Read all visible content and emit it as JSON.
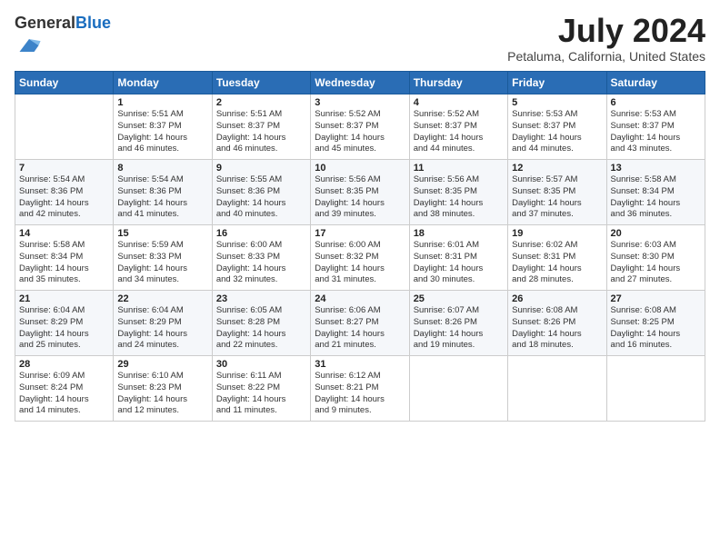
{
  "logo": {
    "general": "General",
    "blue": "Blue"
  },
  "title": {
    "month_year": "July 2024",
    "location": "Petaluma, California, United States"
  },
  "header_days": [
    "Sunday",
    "Monday",
    "Tuesday",
    "Wednesday",
    "Thursday",
    "Friday",
    "Saturday"
  ],
  "weeks": [
    [
      {
        "day": "",
        "info": ""
      },
      {
        "day": "1",
        "info": "Sunrise: 5:51 AM\nSunset: 8:37 PM\nDaylight: 14 hours\nand 46 minutes."
      },
      {
        "day": "2",
        "info": "Sunrise: 5:51 AM\nSunset: 8:37 PM\nDaylight: 14 hours\nand 46 minutes."
      },
      {
        "day": "3",
        "info": "Sunrise: 5:52 AM\nSunset: 8:37 PM\nDaylight: 14 hours\nand 45 minutes."
      },
      {
        "day": "4",
        "info": "Sunrise: 5:52 AM\nSunset: 8:37 PM\nDaylight: 14 hours\nand 44 minutes."
      },
      {
        "day": "5",
        "info": "Sunrise: 5:53 AM\nSunset: 8:37 PM\nDaylight: 14 hours\nand 44 minutes."
      },
      {
        "day": "6",
        "info": "Sunrise: 5:53 AM\nSunset: 8:37 PM\nDaylight: 14 hours\nand 43 minutes."
      }
    ],
    [
      {
        "day": "7",
        "info": "Sunrise: 5:54 AM\nSunset: 8:36 PM\nDaylight: 14 hours\nand 42 minutes."
      },
      {
        "day": "8",
        "info": "Sunrise: 5:54 AM\nSunset: 8:36 PM\nDaylight: 14 hours\nand 41 minutes."
      },
      {
        "day": "9",
        "info": "Sunrise: 5:55 AM\nSunset: 8:36 PM\nDaylight: 14 hours\nand 40 minutes."
      },
      {
        "day": "10",
        "info": "Sunrise: 5:56 AM\nSunset: 8:35 PM\nDaylight: 14 hours\nand 39 minutes."
      },
      {
        "day": "11",
        "info": "Sunrise: 5:56 AM\nSunset: 8:35 PM\nDaylight: 14 hours\nand 38 minutes."
      },
      {
        "day": "12",
        "info": "Sunrise: 5:57 AM\nSunset: 8:35 PM\nDaylight: 14 hours\nand 37 minutes."
      },
      {
        "day": "13",
        "info": "Sunrise: 5:58 AM\nSunset: 8:34 PM\nDaylight: 14 hours\nand 36 minutes."
      }
    ],
    [
      {
        "day": "14",
        "info": "Sunrise: 5:58 AM\nSunset: 8:34 PM\nDaylight: 14 hours\nand 35 minutes."
      },
      {
        "day": "15",
        "info": "Sunrise: 5:59 AM\nSunset: 8:33 PM\nDaylight: 14 hours\nand 34 minutes."
      },
      {
        "day": "16",
        "info": "Sunrise: 6:00 AM\nSunset: 8:33 PM\nDaylight: 14 hours\nand 32 minutes."
      },
      {
        "day": "17",
        "info": "Sunrise: 6:00 AM\nSunset: 8:32 PM\nDaylight: 14 hours\nand 31 minutes."
      },
      {
        "day": "18",
        "info": "Sunrise: 6:01 AM\nSunset: 8:31 PM\nDaylight: 14 hours\nand 30 minutes."
      },
      {
        "day": "19",
        "info": "Sunrise: 6:02 AM\nSunset: 8:31 PM\nDaylight: 14 hours\nand 28 minutes."
      },
      {
        "day": "20",
        "info": "Sunrise: 6:03 AM\nSunset: 8:30 PM\nDaylight: 14 hours\nand 27 minutes."
      }
    ],
    [
      {
        "day": "21",
        "info": "Sunrise: 6:04 AM\nSunset: 8:29 PM\nDaylight: 14 hours\nand 25 minutes."
      },
      {
        "day": "22",
        "info": "Sunrise: 6:04 AM\nSunset: 8:29 PM\nDaylight: 14 hours\nand 24 minutes."
      },
      {
        "day": "23",
        "info": "Sunrise: 6:05 AM\nSunset: 8:28 PM\nDaylight: 14 hours\nand 22 minutes."
      },
      {
        "day": "24",
        "info": "Sunrise: 6:06 AM\nSunset: 8:27 PM\nDaylight: 14 hours\nand 21 minutes."
      },
      {
        "day": "25",
        "info": "Sunrise: 6:07 AM\nSunset: 8:26 PM\nDaylight: 14 hours\nand 19 minutes."
      },
      {
        "day": "26",
        "info": "Sunrise: 6:08 AM\nSunset: 8:26 PM\nDaylight: 14 hours\nand 18 minutes."
      },
      {
        "day": "27",
        "info": "Sunrise: 6:08 AM\nSunset: 8:25 PM\nDaylight: 14 hours\nand 16 minutes."
      }
    ],
    [
      {
        "day": "28",
        "info": "Sunrise: 6:09 AM\nSunset: 8:24 PM\nDaylight: 14 hours\nand 14 minutes."
      },
      {
        "day": "29",
        "info": "Sunrise: 6:10 AM\nSunset: 8:23 PM\nDaylight: 14 hours\nand 12 minutes."
      },
      {
        "day": "30",
        "info": "Sunrise: 6:11 AM\nSunset: 8:22 PM\nDaylight: 14 hours\nand 11 minutes."
      },
      {
        "day": "31",
        "info": "Sunrise: 6:12 AM\nSunset: 8:21 PM\nDaylight: 14 hours\nand 9 minutes."
      },
      {
        "day": "",
        "info": ""
      },
      {
        "day": "",
        "info": ""
      },
      {
        "day": "",
        "info": ""
      }
    ]
  ]
}
